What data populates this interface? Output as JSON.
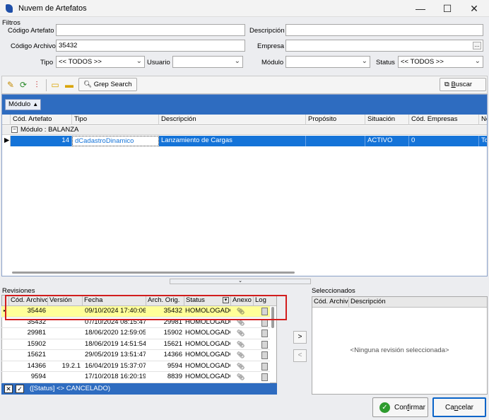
{
  "window": {
    "title": "Nuvem de Artefatos",
    "minimize": "—",
    "maximize": "☐",
    "close": "✕"
  },
  "filters": {
    "section_title": "Filtros",
    "codigo_artefato_label": "Código Artefato",
    "codigo_artefato_value": "",
    "descripcion_label": "Descripción",
    "descripcion_value": "",
    "codigo_archivo_label": "Código Archivo",
    "codigo_archivo_value": "35432",
    "empresa_label": "Empresa",
    "empresa_value": "",
    "empresa_ellipsis": "...",
    "tipo_label": "Tipo",
    "tipo_value": "<< TODOS >>",
    "usuario_label": "Usuario",
    "usuario_value": "",
    "modulo_label": "Módulo",
    "modulo_value": "",
    "status_label": "Status",
    "status_value": "<< TODOS >>"
  },
  "toolbar": {
    "grep_label": "Grep Search",
    "buscar_label": "Buscar",
    "buscar_underline": "B"
  },
  "grid": {
    "group_chip": "Módulo",
    "columns": [
      "Cód. Artefato",
      "Tipo",
      "Descripción",
      "Propósito",
      "Situación",
      "Cód. Empresas",
      "No"
    ],
    "group_row": "Módulo : BALANZA",
    "rows": [
      {
        "codigo": "14",
        "tipo": "dCadastroDinamico",
        "descripcion": "Lanzamiento de Cargas",
        "proposito": "",
        "situacion": "ACTIVO",
        "empresas": "0",
        "no": "Tod"
      }
    ]
  },
  "revisiones": {
    "title": "Revisiones",
    "columns": [
      "Cód. Archivo",
      "Versión",
      "Fecha",
      "Arch. Orig.",
      "Status",
      "Anexo",
      "Log"
    ],
    "rows": [
      {
        "codigo": "35446",
        "version": "",
        "fecha": "09/10/2024 17:40:06",
        "orig": "35432",
        "status": "HOMOLOGADO"
      },
      {
        "codigo": "35432",
        "version": "",
        "fecha": "07/10/2024 08:15:47",
        "orig": "29981",
        "status": "HOMOLOGADO"
      },
      {
        "codigo": "29981",
        "version": "",
        "fecha": "18/06/2020 12:59:05",
        "orig": "15902",
        "status": "HOMOLOGADO"
      },
      {
        "codigo": "15902",
        "version": "",
        "fecha": "18/06/2019 14:51:54",
        "orig": "15621",
        "status": "HOMOLOGADO"
      },
      {
        "codigo": "15621",
        "version": "",
        "fecha": "29/05/2019 13:51:47",
        "orig": "14366",
        "status": "HOMOLOGADO"
      },
      {
        "codigo": "14366",
        "version": "19.2.1",
        "fecha": "16/04/2019 15:37:07",
        "orig": "9594",
        "status": "HOMOLOGADO"
      },
      {
        "codigo": "9594",
        "version": "",
        "fecha": "17/10/2018 16:20:19",
        "orig": "8839",
        "status": "HOMOLOGADO"
      }
    ],
    "filter_text": "([Status] <> CANCELADO)"
  },
  "seleccionados": {
    "title": "Seleccionados",
    "columns": [
      "Cód. Archivo",
      "Descripción"
    ],
    "empty_text": "<Ninguna revisión seleccionada>"
  },
  "move": {
    "add": ">",
    "remove": "<"
  },
  "footer": {
    "confirmar_pre": "Con",
    "confirmar_u": "f",
    "confirmar_post": "irmar",
    "cancelar_pre": "Ca",
    "cancelar_u": "n",
    "cancelar_post": "celar"
  },
  "colors": {
    "selection": "#1473d8",
    "group_band": "#2e6cc0",
    "highlight_row": "#ffff99",
    "callout": "#d21d1d"
  }
}
